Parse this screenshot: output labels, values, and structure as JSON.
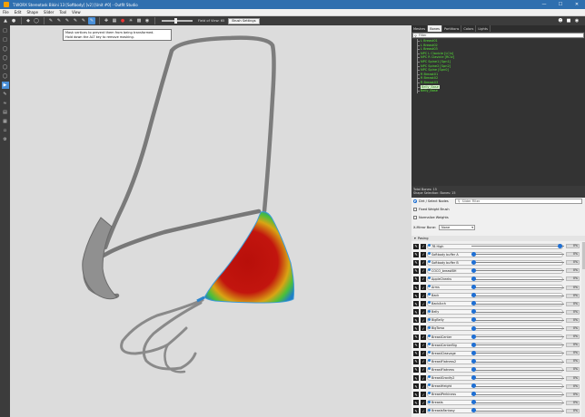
{
  "window": {
    "title": "T.WORX Stereotask Bikini 13 [Softbody] [v2] [Unit #0] - Outfit Studio"
  },
  "menu": [
    "File",
    "Edit",
    "Shape",
    "Slider",
    "Tool",
    "View"
  ],
  "toolbar": {
    "fov_label": "Field of View: 65",
    "brush_settings_label": "Brush Settings"
  },
  "tooltip": {
    "line1": "Mask vertices to prevent them from being transformed.",
    "line2": "Hold down the ALT key to remove masking."
  },
  "panel": {
    "tabs": [
      {
        "label": "Meshes",
        "selected": false
      },
      {
        "label": "Bones",
        "selected": true
      },
      {
        "label": "Partitions",
        "selected": false
      },
      {
        "label": "Colors",
        "selected": false
      },
      {
        "label": "Lights",
        "selected": false
      }
    ],
    "filter_placeholder": "Filter",
    "bones": [
      {
        "name": "L Breast01",
        "selected": false
      },
      {
        "name": "L Breast02",
        "selected": false
      },
      {
        "name": "L Breast03",
        "selected": false
      },
      {
        "name": "NPC L Clavicle [LClv]",
        "selected": false
      },
      {
        "name": "NPC R Clavicle [RClv]",
        "selected": false
      },
      {
        "name": "NPC Spine1 [Spn1]",
        "selected": false
      },
      {
        "name": "NPC Spine2 [Spn2]",
        "selected": false
      },
      {
        "name": "NPC Spine [Spn0]",
        "selected": false
      },
      {
        "name": "R Breast01",
        "selected": false
      },
      {
        "name": "R Breast02",
        "selected": false
      },
      {
        "name": "R Breast03",
        "selected": false
      },
      {
        "name": "Belly_Base",
        "selected": true
      },
      {
        "name": "Belly_Base",
        "selected": false
      }
    ],
    "info_line1": "Total Bones: 15",
    "info_line2": "Shape Selection: Bones: 15",
    "weights": {
      "xmirror_label": "Dirt / Select Nodes",
      "slider_filter_placeholder": "Slider Filter",
      "fixed_weight_label": "Fixed Weight Brush",
      "normalize_label": "Normalize Weights",
      "x_mirror_bone_label": "X-Mirror Bone:",
      "x_mirror_bone_value": "None"
    },
    "posing_header": "Posing",
    "sliders": [
      {
        "name": "7B High",
        "value": 0.97,
        "pct": "0%"
      },
      {
        "name": "Softbody buffer A",
        "value": 0.0,
        "pct": "0%"
      },
      {
        "name": "Softbody buffer B",
        "value": 0.0,
        "pct": "0%"
      },
      {
        "name": "COCO_breastBH",
        "value": 0.0,
        "pct": "0%"
      },
      {
        "name": "AppleCheeks",
        "value": 0.0,
        "pct": "0%"
      },
      {
        "name": "Arms",
        "value": 0.0,
        "pct": "0%"
      },
      {
        "name": "Back",
        "value": 0.0,
        "pct": "0%"
      },
      {
        "name": "BackArch",
        "value": 0.0,
        "pct": "0%"
      },
      {
        "name": "Belly",
        "value": 0.0,
        "pct": "0%"
      },
      {
        "name": "BigBelly",
        "value": 0.0,
        "pct": "0%"
      },
      {
        "name": "BigTorso",
        "value": 0.0,
        "pct": "0%"
      },
      {
        "name": "BreastCenter",
        "value": 0.0,
        "pct": "0%"
      },
      {
        "name": "BreastCenterBig",
        "value": 0.0,
        "pct": "0%"
      },
      {
        "name": "BreastCleavage",
        "value": 0.0,
        "pct": "0%"
      },
      {
        "name": "BreastFlatness2",
        "value": 0.0,
        "pct": "0%"
      },
      {
        "name": "BreastFlatness",
        "value": 0.0,
        "pct": "0%"
      },
      {
        "name": "BreastGravity2",
        "value": 0.0,
        "pct": "0%"
      },
      {
        "name": "BreastHeight",
        "value": 0.0,
        "pct": "0%"
      },
      {
        "name": "BreastPerkiness",
        "value": 0.0,
        "pct": "0%"
      },
      {
        "name": "Breasts",
        "value": 0.0,
        "pct": "0%"
      },
      {
        "name": "BreastsFantasy",
        "value": 0.0,
        "pct": "0%"
      },
      {
        "name": "BreastsGone",
        "value": 0.0,
        "pct": "0%"
      },
      {
        "name": "BreastsNewSH",
        "value": 0.0,
        "pct": "0%"
      }
    ]
  }
}
